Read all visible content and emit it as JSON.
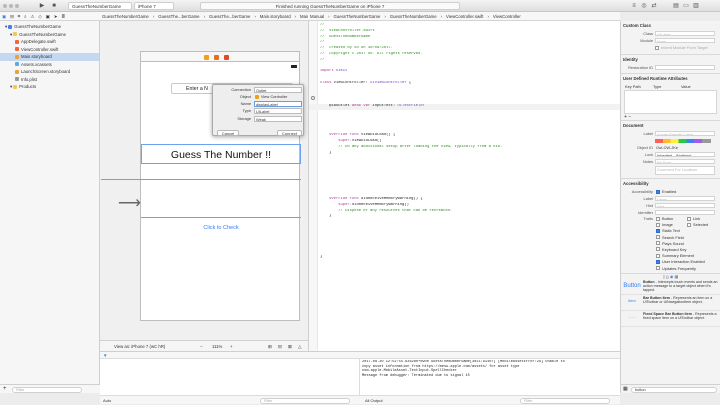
{
  "toolbar": {
    "scheme_project": "GuessTheNumberGame",
    "scheme_device": "iPhone 7",
    "status": "Finished running GuessTheNumberGame on iPhone 7"
  },
  "left_jump": [
    "GuessTheNumberGame",
    "GuessThe...berGame",
    "GuessThe...berGame",
    "Main.storyboard",
    "Main.storyb...",
    "View Controller Scene",
    "View Controller",
    "Guess The Number !!"
  ],
  "right_jump": [
    "Manual",
    "GuessTheNumberGame",
    "GuessTheNumberGame",
    "ViewController.swift",
    "ViewController"
  ],
  "navigator": {
    "items": [
      {
        "label": "GuessTheNumberGame",
        "indent": 1,
        "icon": "project-icon",
        "selected": false
      },
      {
        "label": "GuessTheNumberGame",
        "indent": 2,
        "icon": "folder-icon",
        "selected": false
      },
      {
        "label": "AppDelegate.swift",
        "indent": 3,
        "icon": "swift-file-icon",
        "selected": false
      },
      {
        "label": "ViewController.swift",
        "indent": 3,
        "icon": "swift-file-icon",
        "selected": false
      },
      {
        "label": "Main.storyboard",
        "indent": 3,
        "icon": "storyboard-icon",
        "selected": true
      },
      {
        "label": "Assets.xcassets",
        "indent": 3,
        "icon": "assets-icon",
        "selected": false
      },
      {
        "label": "LaunchScreen.storyboard",
        "indent": 3,
        "icon": "storyboard-icon",
        "selected": false
      },
      {
        "label": "Info.plist",
        "indent": 3,
        "icon": "plist-icon",
        "selected": false
      },
      {
        "label": "Products",
        "indent": 2,
        "icon": "folder-icon",
        "selected": false
      }
    ]
  },
  "storyboard": {
    "textfield_placeholder": "Enter a N",
    "title_label": "Guess The Number !!",
    "check_button": "Click to Check",
    "view_as": "View as: iPhone 7 (wC hR)",
    "zoom": "111%"
  },
  "popup": {
    "connection_label": "Connection",
    "connection_value": "Outlet",
    "object_label": "Object",
    "object_value": "View Controller",
    "name_label": "Name",
    "name_value": "displayLabel",
    "type_label": "Type",
    "type_value": "UILabel",
    "storage_label": "Storage",
    "storage_value": "Weak",
    "cancel": "Cancel",
    "connect": "Connect"
  },
  "code": [
    {
      "t": "//",
      "c": "comment"
    },
    {
      "t": "//  ViewController.swift",
      "c": "comment"
    },
    {
      "t": "//  GuessTheNumberGame",
      "c": "comment"
    },
    {
      "t": "//",
      "c": "comment"
    },
    {
      "t": "//  Created by Sn on 30/08/2017.",
      "c": "comment"
    },
    {
      "t": "//  Copyright © 2017 Sn. All rights reserved.",
      "c": "comment"
    },
    {
      "t": "//",
      "c": "comment"
    },
    {
      "t": "",
      "c": "plain"
    },
    {
      "t": "import UIKit",
      "c": "plain"
    },
    {
      "t": "",
      "c": "plain"
    },
    {
      "t": "class ViewController: UIViewController {",
      "c": "plain"
    },
    {
      "t": "",
      "c": "plain"
    },
    {
      "t": "",
      "c": "plain"
    },
    {
      "t": "",
      "c": "plain"
    },
    {
      "t": "    @IBOutlet weak var inputText: UITextField!",
      "c": "plain"
    },
    {
      "t": "",
      "c": "plain"
    },
    {
      "t": "",
      "c": "plain"
    },
    {
      "t": "",
      "c": "plain"
    },
    {
      "t": "",
      "c": "plain"
    },
    {
      "t": "    override func viewDidLoad() {",
      "c": "plain"
    },
    {
      "t": "        super.viewDidLoad()",
      "c": "plain"
    },
    {
      "t": "        // Do any additional setup after loading the view, typically from a nib.",
      "c": "comment"
    },
    {
      "t": "    }",
      "c": "plain"
    },
    {
      "t": "",
      "c": "plain"
    },
    {
      "t": "",
      "c": "plain"
    },
    {
      "t": "",
      "c": "plain"
    },
    {
      "t": "",
      "c": "plain"
    },
    {
      "t": "",
      "c": "plain"
    },
    {
      "t": "",
      "c": "plain"
    },
    {
      "t": "",
      "c": "plain"
    },
    {
      "t": "    override func didReceiveMemoryWarning() {",
      "c": "plain"
    },
    {
      "t": "        super.didReceiveMemoryWarning()",
      "c": "plain"
    },
    {
      "t": "        // Dispose of any resources that can be recreated.",
      "c": "comment"
    },
    {
      "t": "    }",
      "c": "plain"
    },
    {
      "t": "",
      "c": "plain"
    },
    {
      "t": "",
      "c": "plain"
    },
    {
      "t": "",
      "c": "plain"
    },
    {
      "t": "",
      "c": "plain"
    },
    {
      "t": "",
      "c": "plain"
    },
    {
      "t": "",
      "c": "plain"
    },
    {
      "t": "}",
      "c": "plain"
    }
  ],
  "console": [
    "2017-08-30 12:52:55.636280+0900 GuessTheNumberGame[3011:91407] [MobileAssetError:29] Unable to",
    "copy asset information from https://mesu.apple.com/assets/ for asset type",
    "com.apple.MobileAsset.TextInput.SpellChecker",
    "Message from debugger: Terminated due to signal 15"
  ],
  "bottom": {
    "auto_label": "Auto",
    "output_label": "All Output",
    "filter": "Filter"
  },
  "inspector": {
    "custom_class": {
      "header": "Custom Class",
      "class_label": "Class",
      "class_value": "UILabel",
      "module_label": "Module",
      "module_value": "None",
      "inherit": "Inherit Module From Target"
    },
    "identity": {
      "header": "Identity",
      "restoration_label": "Restoration ID"
    },
    "udra": {
      "header": "User Defined Runtime Attributes",
      "cols": [
        "Key Path",
        "Type",
        "Value"
      ]
    },
    "document": {
      "header": "Document",
      "label_label": "Label",
      "label_ph": "Xcode Specific Label",
      "object_id_label": "Object ID",
      "object_id": "Out-CW-JKe",
      "lock_label": "Lock",
      "lock_value": "Inherited - (Nothing)",
      "notes_label": "Notes",
      "notes_ph": "No Font",
      "comment_ph": "Comment For Localizer"
    },
    "accessibility": {
      "header": "Accessibility",
      "acc_label": "Accessibility",
      "enabled": "Enabled",
      "label_label": "Label",
      "label_ph": "Label",
      "hint_label": "Hint",
      "hint_ph": "Hint",
      "identifier_label": "Identifier",
      "traits_label": "Traits",
      "traits": [
        {
          "a": "Button",
          "b": "Link",
          "on": false
        },
        {
          "a": "Image",
          "b": "Selected",
          "on": false
        },
        {
          "a": "Static Text",
          "b": "",
          "on": true
        },
        {
          "a": "Search Field",
          "b": "",
          "on": false
        },
        {
          "a": "Plays Sound",
          "b": "",
          "on": false
        },
        {
          "a": "Keyboard Key",
          "b": "",
          "on": false
        },
        {
          "a": "Summary Element",
          "b": "",
          "on": false
        },
        {
          "a": "User Interaction Enabled",
          "b": "",
          "on": true
        },
        {
          "a": "Updates Frequently",
          "b": "",
          "on": false
        }
      ]
    },
    "library": [
      {
        "icon": "Button",
        "title": "Button",
        "desc": "- Intercepts touch events and sends an action message to a target object when it's tapped."
      },
      {
        "icon": "Item",
        "title": "Bar Button Item",
        "desc": "- Represents an item on a UIToolbar or UINavigationItem object."
      },
      {
        "icon": "- - -",
        "title": "Fixed Space Bar Button Item",
        "desc": "- Represents a fixed space item on a UIToolbar object."
      }
    ],
    "filter": "button"
  },
  "colors": {
    "keyword": "#b3359b",
    "comment": "#2a8a1e",
    "type": "#6e3ec2",
    "selection": "#c4d8f1",
    "accent": "#3b83f0"
  }
}
